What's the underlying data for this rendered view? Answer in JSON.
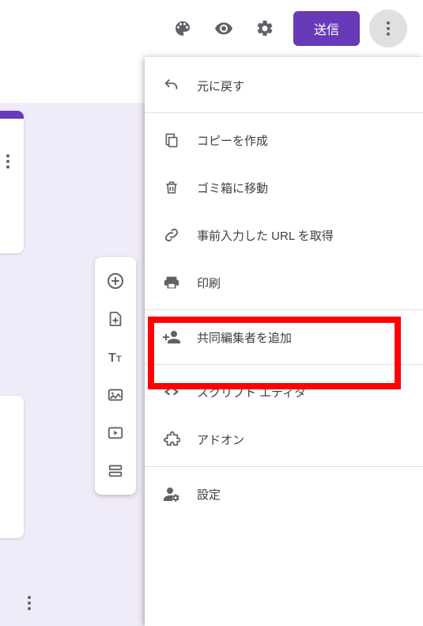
{
  "topbar": {
    "send_label": "送信"
  },
  "menu": {
    "undo": "元に戻す",
    "copy": "コピーを作成",
    "trash": "ゴミ箱に移動",
    "prefill": "事前入力した URL を取得",
    "print": "印刷",
    "collaborators": "共同編集者を追加",
    "script": "スクリプト エディタ",
    "addons": "アドオン",
    "settings": "設定"
  }
}
